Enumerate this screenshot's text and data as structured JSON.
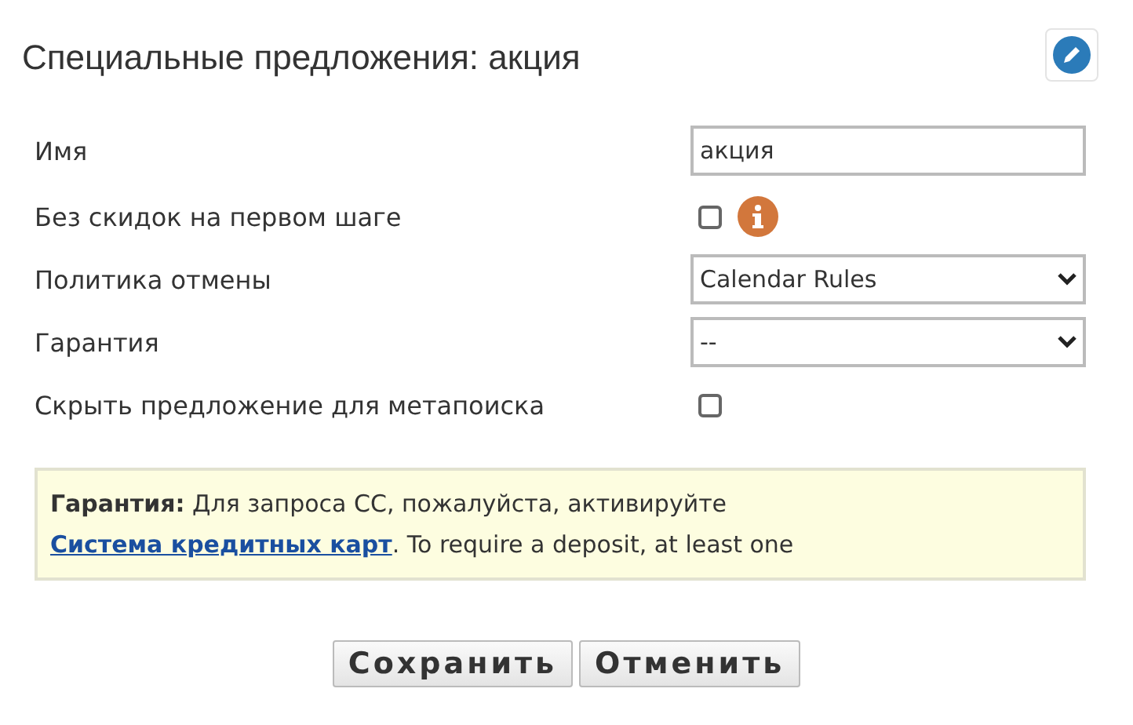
{
  "title": "Специальные предложения: акция",
  "fields": [
    {
      "kind": "text",
      "label": "Имя",
      "value": "акция"
    },
    {
      "kind": "checkbox",
      "label": "Без скидок на первом шаге",
      "checked": false,
      "info": true
    },
    {
      "kind": "select",
      "label": "Политика отмены",
      "value": "Calendar Rules"
    },
    {
      "kind": "select",
      "label": "Гарантия",
      "value": "--"
    },
    {
      "kind": "checkbox",
      "label": "Скрыть предложение для метапоиска",
      "checked": false,
      "info": false
    }
  ],
  "note": {
    "text": "**Гарантия:**  Для запроса CC, пожалуйста, активируйте ",
    "link": "Система кредитных карт",
    "after": ". To require a deposit, at least one"
  },
  "buttons": [
    "Сохранить",
    "Отменить"
  ]
}
